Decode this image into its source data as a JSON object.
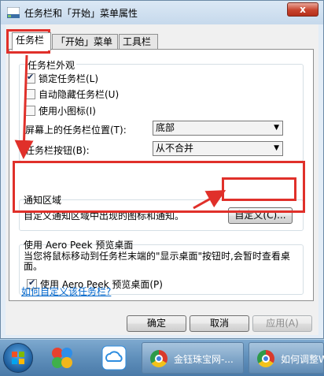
{
  "window": {
    "title": "任务栏和「开始」菜单属性",
    "close_label": "x"
  },
  "tabs": [
    {
      "label": "任务栏",
      "active": true
    },
    {
      "label": "「开始」菜单",
      "active": false
    },
    {
      "label": "工具栏",
      "active": false
    }
  ],
  "appearance": {
    "title": "任务栏外观",
    "lock_taskbar": {
      "label": "锁定任务栏(L)",
      "checked": true
    },
    "autohide": {
      "label": "自动隐藏任务栏(U)",
      "checked": false
    },
    "small_icons": {
      "label": "使用小图标(I)",
      "checked": false
    },
    "position": {
      "label": "屏幕上的任务栏位置(T):",
      "value": "底部"
    },
    "buttons": {
      "label": "任务栏按钮(B):",
      "value": "从不合并"
    }
  },
  "notification": {
    "title": "通知区域",
    "description": "自定义通知区域中出现的图标和通知。",
    "customize_label": "自定义(C)..."
  },
  "aero_peek": {
    "title": "使用 Aero Peek 预览桌面",
    "description": "当您将鼠标移动到任务栏末端的\"显示桌面\"按钮时,会暂时查看桌面。",
    "checkbox": {
      "label": "使用 Aero Peek 预览桌面(P)",
      "checked": true
    }
  },
  "help_link": "如何自定义该任务栏?",
  "footer": {
    "ok": "确定",
    "cancel": "取消",
    "apply": "应用(A)"
  },
  "taskbar": {
    "apps": [
      {
        "label": "金钰珠宝网-..."
      },
      {
        "label": "如何调整Wi"
      }
    ]
  },
  "colors": {
    "highlight": "#e0302a",
    "link": "#0066cc"
  }
}
